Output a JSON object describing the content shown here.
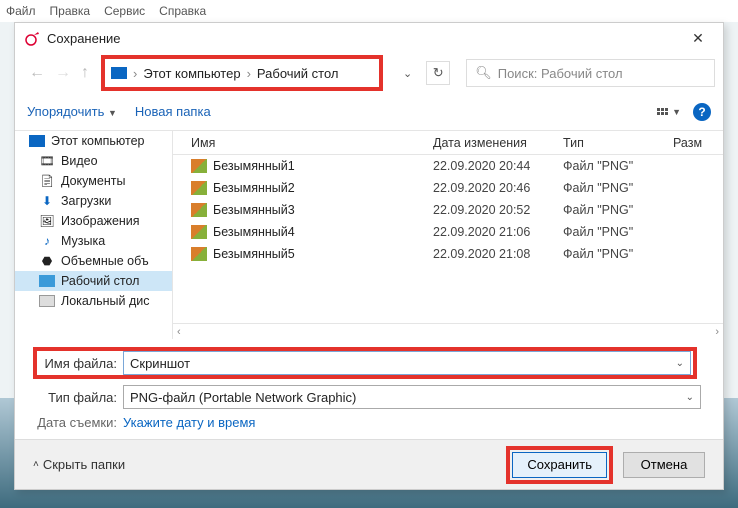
{
  "menubar": {
    "items": [
      "Файл",
      "Правка",
      "Сервис",
      "Справка"
    ]
  },
  "dialog": {
    "title": "Сохранение",
    "breadcrumb": {
      "part1": "Этот компьютер",
      "part2": "Рабочий стол"
    },
    "search_placeholder": "Поиск: Рабочий стол",
    "toolbar": {
      "organize": "Упорядочить",
      "new_folder": "Новая папка"
    },
    "columns": {
      "name": "Имя",
      "date": "Дата изменения",
      "type": "Тип",
      "size": "Разм"
    },
    "sidebar": {
      "items": [
        {
          "label": "Этот компьютер",
          "icon": "pc"
        },
        {
          "label": "Видео",
          "icon": "video"
        },
        {
          "label": "Документы",
          "icon": "doc"
        },
        {
          "label": "Загрузки",
          "icon": "down"
        },
        {
          "label": "Изображения",
          "icon": "img"
        },
        {
          "label": "Музыка",
          "icon": "music"
        },
        {
          "label": "Объемные объ",
          "icon": "3d"
        },
        {
          "label": "Рабочий стол",
          "icon": "desk"
        },
        {
          "label": "Локальный дис",
          "icon": "disk"
        }
      ],
      "selected_index": 7
    },
    "files": [
      {
        "name": "Безымянный1",
        "date": "22.09.2020 20:44",
        "type": "Файл \"PNG\""
      },
      {
        "name": "Безымянный2",
        "date": "22.09.2020 20:46",
        "type": "Файл \"PNG\""
      },
      {
        "name": "Безымянный3",
        "date": "22.09.2020 20:52",
        "type": "Файл \"PNG\""
      },
      {
        "name": "Безымянный4",
        "date": "22.09.2020 21:06",
        "type": "Файл \"PNG\""
      },
      {
        "name": "Безымянный5",
        "date": "22.09.2020 21:08",
        "type": "Файл \"PNG\""
      }
    ],
    "form": {
      "filename_label": "Имя файла:",
      "filename_value": "Скриншот",
      "filetype_label": "Тип файла:",
      "filetype_value": "PNG-файл (Portable Network Graphic)",
      "date_taken_label": "Дата съемки:",
      "date_taken_hint": "Укажите дату и время"
    },
    "buttons": {
      "hide_folders": "Скрыть папки",
      "save": "Сохранить",
      "cancel": "Отмена"
    }
  }
}
